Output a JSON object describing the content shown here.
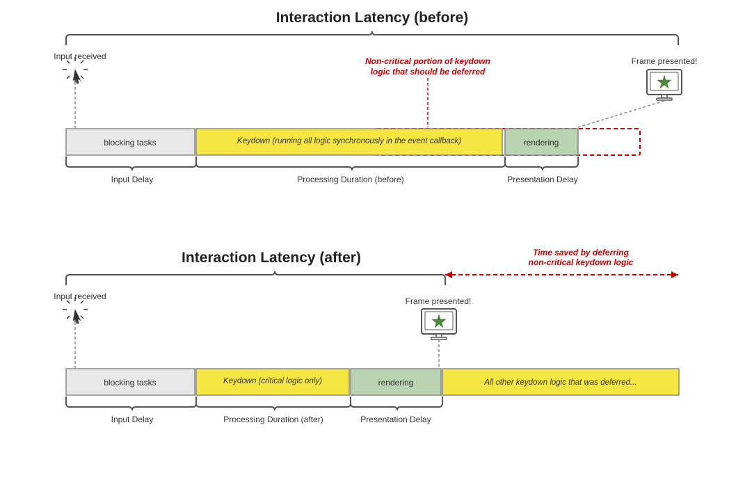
{
  "top": {
    "title": "Interaction Latency (before)",
    "input_received": "Input received",
    "frame_presented": "Frame presented!",
    "annotation_red": "Non-critical portion of keydown logic that should be deferred",
    "bar_blocking": "blocking tasks",
    "bar_keydown": "Keydown (running all logic synchronously in the event callback)",
    "bar_rendering": "rendering",
    "label_input_delay": "Input Delay",
    "label_processing": "Processing Duration (before)",
    "label_presentation": "Presentation Delay"
  },
  "bottom": {
    "title": "Interaction Latency (after)",
    "input_received": "Input received",
    "frame_presented": "Frame presented!",
    "time_saved": "Time saved by deferring non-critical keydown logic",
    "bar_blocking": "blocking tasks",
    "bar_keydown": "Keydown (critical logic only)",
    "bar_rendering": "rendering",
    "bar_deferred": "All other keydown logic that was deferred...",
    "label_input_delay": "Input Delay",
    "label_processing": "Processing Duration (after)",
    "label_presentation": "Presentation Delay"
  }
}
